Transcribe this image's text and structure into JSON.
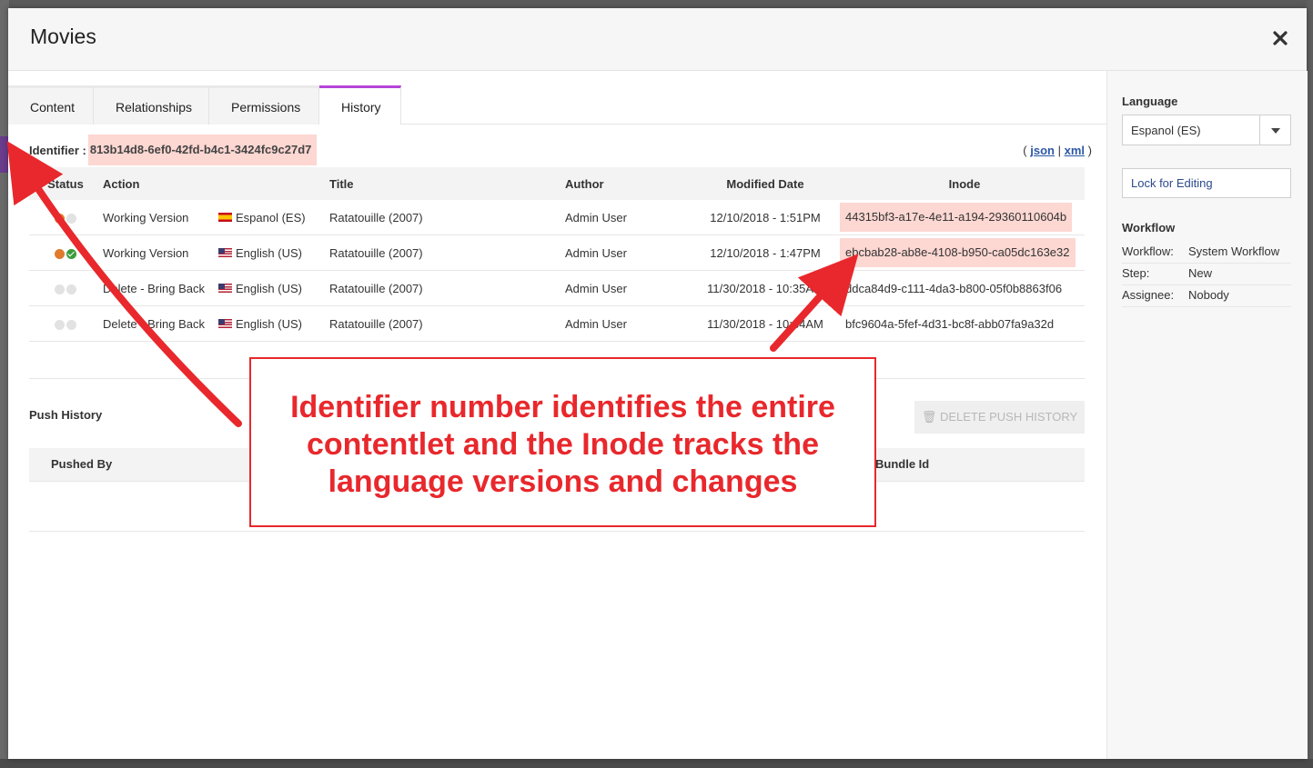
{
  "dialog": {
    "title": "Movies"
  },
  "tabs": [
    {
      "label": "Content"
    },
    {
      "label": "Relationships"
    },
    {
      "label": "Permissions"
    },
    {
      "label": "History"
    }
  ],
  "identifier": {
    "label": "Identifier :",
    "value": "813b14d8-6ef0-42fd-b4c1-3424fc9c27d7"
  },
  "format_links": {
    "open": "(",
    "json": "json",
    "sep": "|",
    "xml": "xml",
    "close": ")"
  },
  "history_table": {
    "headers": {
      "status": "Status",
      "action": "Action",
      "title": "Title",
      "author": "Author",
      "modified": "Modified Date",
      "inode": "Inode"
    },
    "rows": [
      {
        "action": "Working Version",
        "language": "Espanol (ES)",
        "title": "Ratatouille (2007)",
        "author": "Admin User",
        "modified": "12/10/2018 - 1:51PM",
        "inode": "44315bf3-a17e-4e11-a194-29360110604b"
      },
      {
        "action": "Working Version",
        "language": "English (US)",
        "title": "Ratatouille (2007)",
        "author": "Admin User",
        "modified": "12/10/2018 - 1:47PM",
        "inode": "ebcbab28-ab8e-4108-b950-ca05dc163e32"
      },
      {
        "action": "Delete - Bring Back",
        "language": "English (US)",
        "title": "Ratatouille (2007)",
        "author": "Admin User",
        "modified": "11/30/2018 - 10:35AM",
        "inode": "ddca84d9-c111-4da3-b800-05f0b8863f06"
      },
      {
        "action": "Delete - Bring Back",
        "language": "English (US)",
        "title": "Ratatouille (2007)",
        "author": "Admin User",
        "modified": "11/30/2018 - 10:34AM",
        "inode": "bfc9604a-5fef-4d31-bc8f-abb07fa9a32d"
      }
    ]
  },
  "push_history": {
    "title": "Push History",
    "delete_button": "DELETE PUSH HISTORY",
    "headers": {
      "pushed_by": "Pushed By",
      "bundle_id": "Bundle Id"
    }
  },
  "sidebar": {
    "language_label": "Language",
    "language_value": "Espanol (ES)",
    "lock_button": "Lock for Editing",
    "workflow_label": "Workflow",
    "workflow_rows": [
      {
        "key": "Workflow:",
        "value": "System Workflow"
      },
      {
        "key": "Step:",
        "value": "New"
      },
      {
        "key": "Assignee:",
        "value": "Nobody"
      }
    ]
  },
  "annotation": {
    "line1": "Identifier number identifies the entire",
    "line2": "contentlet and the Inode tracks the",
    "line3": "language versions and changes"
  },
  "colors": {
    "accent_tab": "#b545d8",
    "highlight": "#fdd7d2",
    "annotation_red": "#e8282c",
    "link_blue": "#2c57a5"
  }
}
